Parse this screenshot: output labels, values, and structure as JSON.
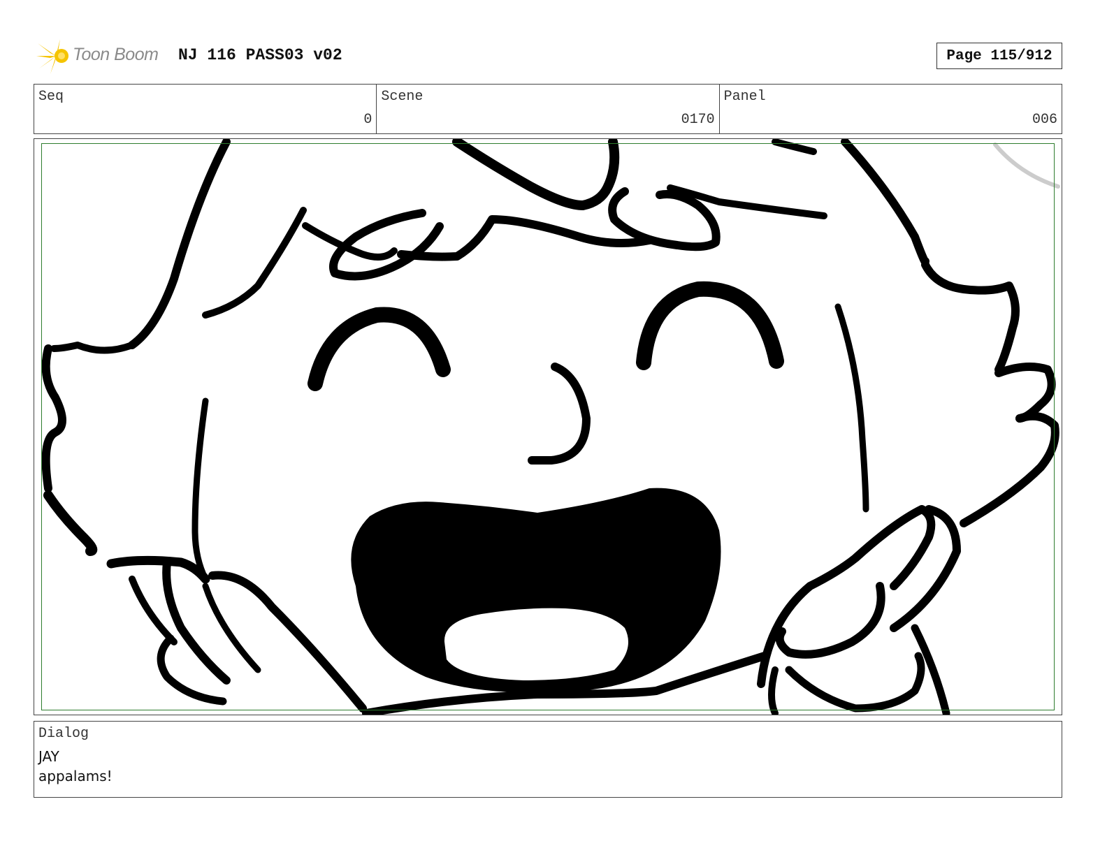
{
  "header": {
    "logo_text": "Toon Boom",
    "document_title": "NJ 116 PASS03 v02",
    "page_indicator": "Page 115/912"
  },
  "info": {
    "seq": {
      "label": "Seq",
      "value": "0"
    },
    "scene": {
      "label": "Scene",
      "value": "0170"
    },
    "panel": {
      "label": "Panel",
      "value": "006"
    }
  },
  "dialog": {
    "label": "Dialog",
    "speaker": "JAY",
    "line": "appalams!"
  },
  "colors": {
    "logo_accent": "#f5c400",
    "safe_frame": "#2e7d2e",
    "ink": "#000000"
  }
}
